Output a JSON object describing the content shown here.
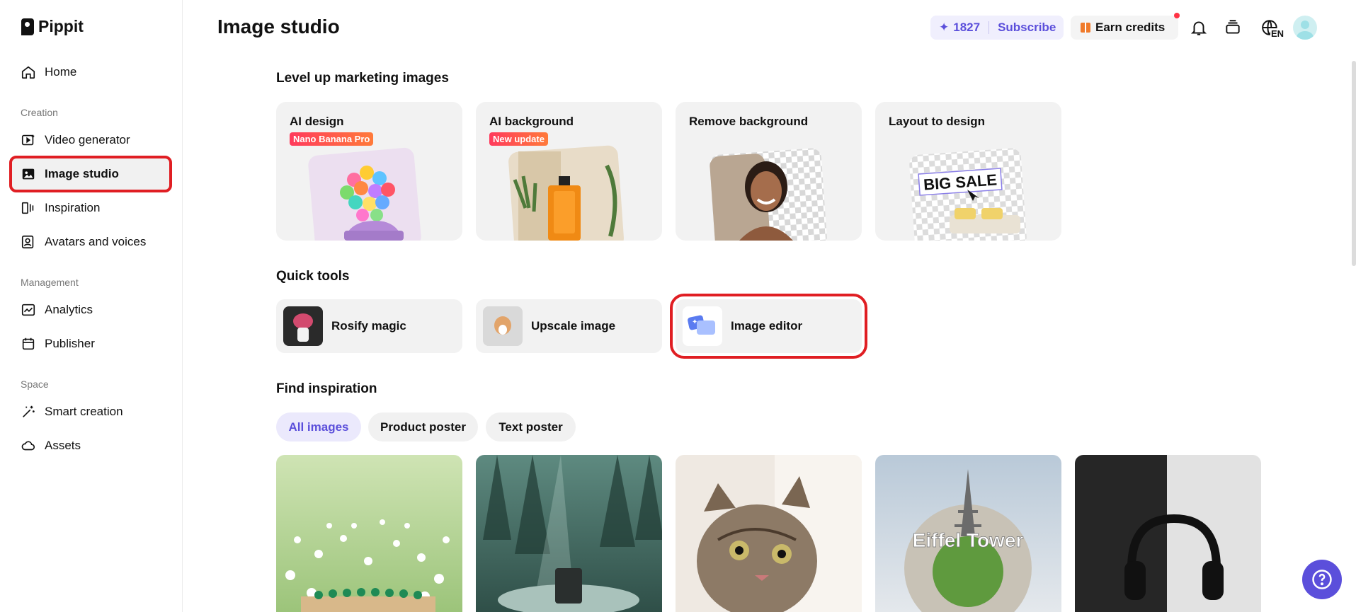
{
  "app": {
    "name": "Pippit"
  },
  "sidebar": {
    "items_main": [
      {
        "label": "Home",
        "icon": "home-icon"
      }
    ],
    "sections": [
      {
        "title": "Creation",
        "items": [
          {
            "label": "Video generator",
            "icon": "video-generator-icon"
          },
          {
            "label": "Image studio",
            "icon": "image-studio-icon",
            "active": true
          },
          {
            "label": "Inspiration",
            "icon": "inspiration-icon"
          },
          {
            "label": "Avatars and voices",
            "icon": "avatar-icon"
          }
        ]
      },
      {
        "title": "Management",
        "items": [
          {
            "label": "Analytics",
            "icon": "analytics-icon"
          },
          {
            "label": "Publisher",
            "icon": "calendar-icon"
          }
        ]
      },
      {
        "title": "Space",
        "items": [
          {
            "label": "Smart creation",
            "icon": "magic-wand-icon"
          },
          {
            "label": "Assets",
            "icon": "cloud-icon"
          }
        ]
      }
    ]
  },
  "header": {
    "title": "Image studio",
    "credits": "1827",
    "subscribe_label": "Subscribe",
    "earn_label": "Earn credits",
    "lang": "EN"
  },
  "marketing": {
    "title": "Level up marketing images",
    "cards": [
      {
        "title": "AI design",
        "badge": "Nano Banana Pro"
      },
      {
        "title": "AI background",
        "badge": "New update"
      },
      {
        "title": "Remove background",
        "badge": ""
      },
      {
        "title": "Layout to design",
        "badge": "",
        "art_text": "BIG SALE"
      }
    ]
  },
  "quick_tools": {
    "title": "Quick tools",
    "items": [
      {
        "label": "Rosify magic"
      },
      {
        "label": "Upscale image"
      },
      {
        "label": "Image editor"
      }
    ]
  },
  "inspiration": {
    "title": "Find inspiration",
    "filters": [
      {
        "label": "All images",
        "active": true
      },
      {
        "label": "Product poster"
      },
      {
        "label": "Text poster"
      }
    ],
    "gallery": [
      {
        "name": "flower-field-bracelet"
      },
      {
        "name": "forest-candle"
      },
      {
        "name": "cat-peeking"
      },
      {
        "name": "eiffel-tower-planet",
        "art_text": "Eiffel Tower"
      },
      {
        "name": "headphones-black-white"
      }
    ]
  },
  "colors": {
    "accent": "#5b4fdb",
    "highlight": "#e01e23"
  }
}
